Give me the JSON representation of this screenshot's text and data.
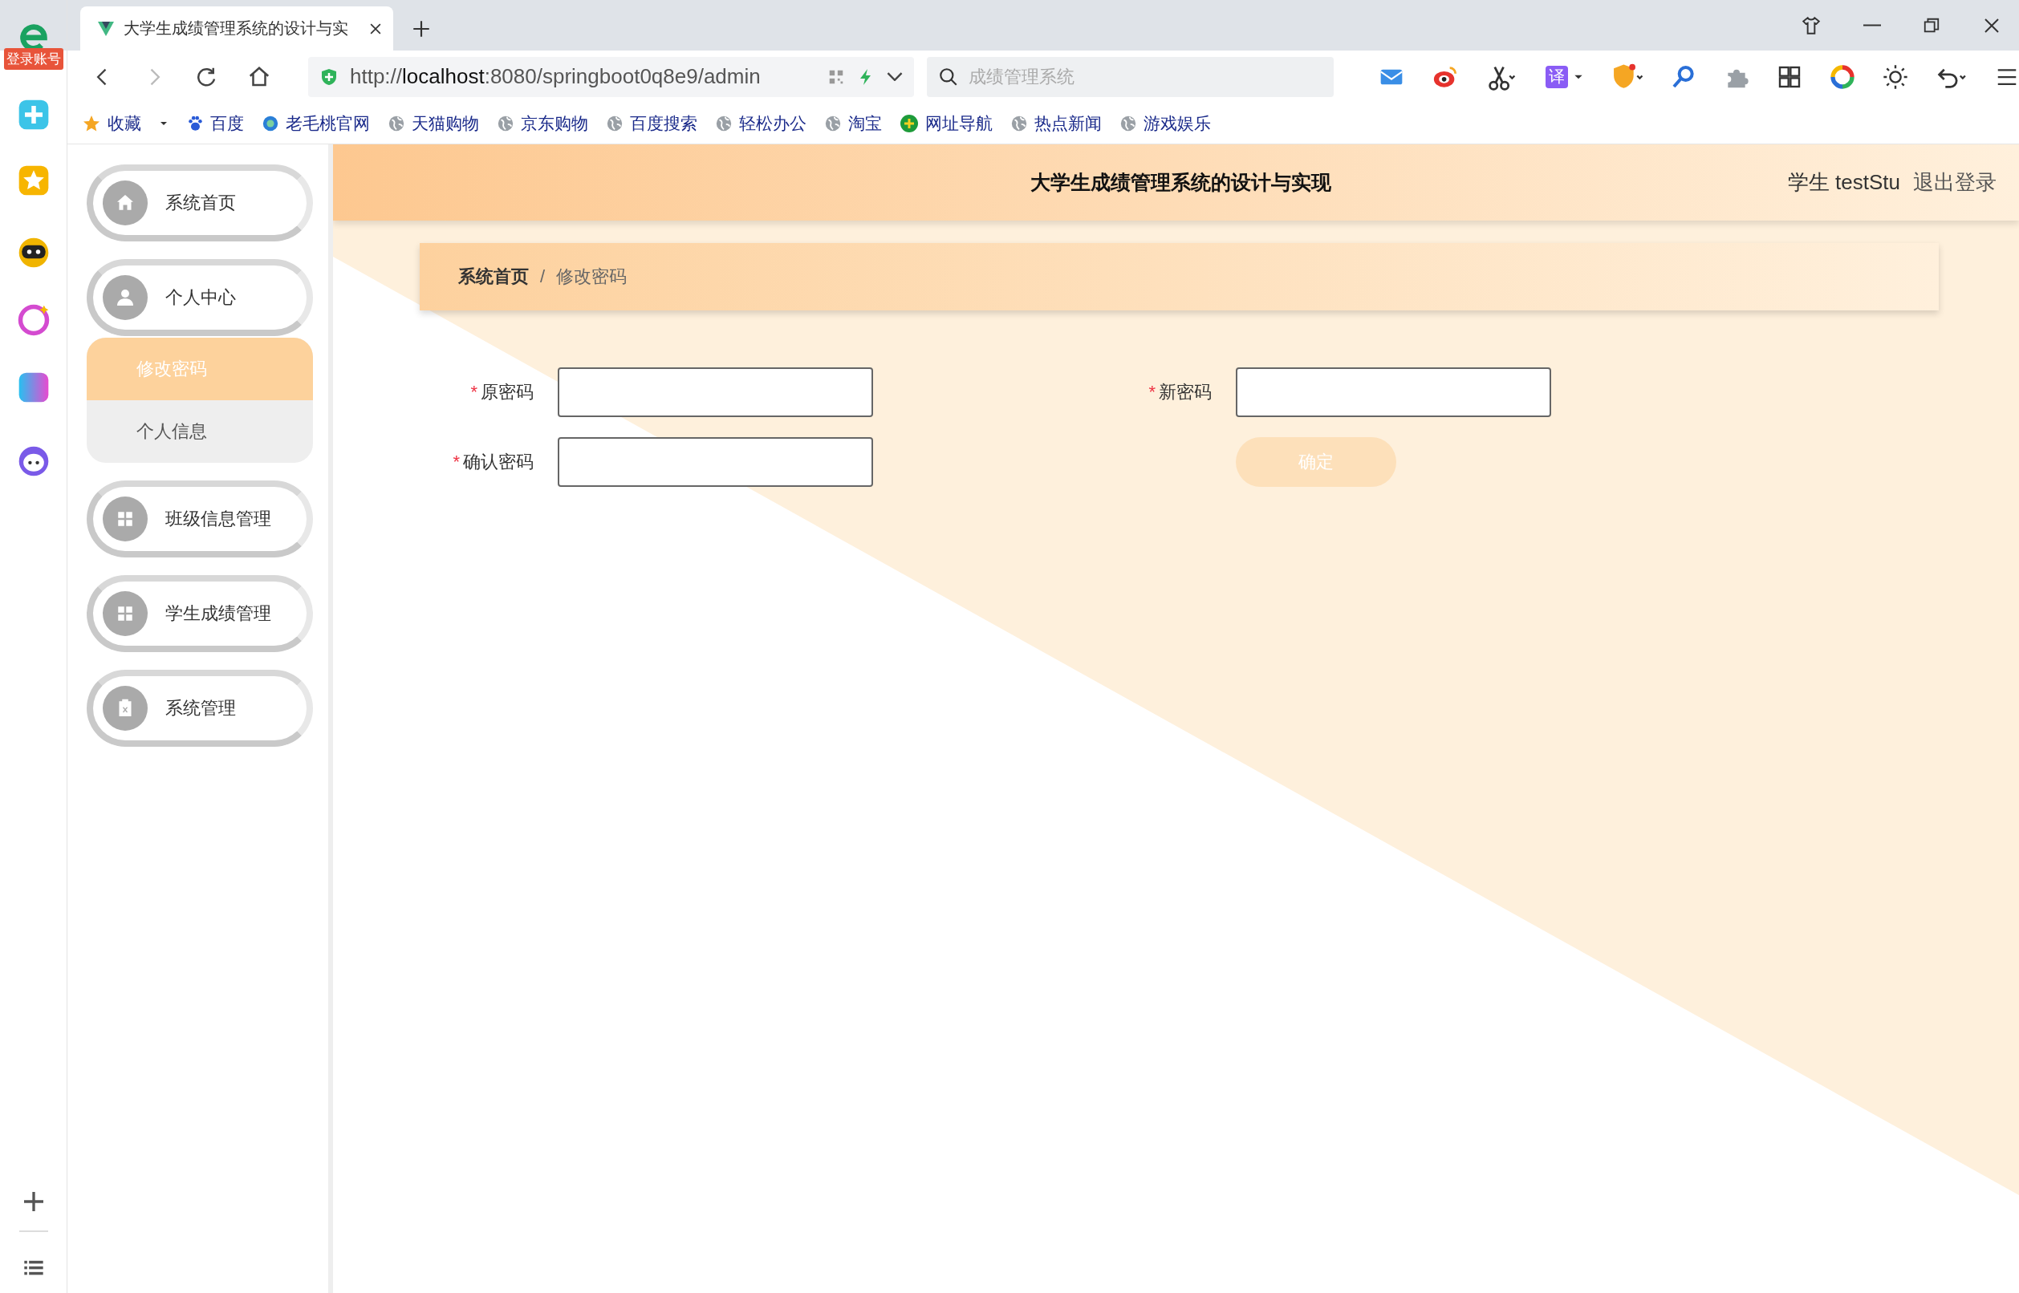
{
  "browser": {
    "side_badge": "登录账号",
    "tab_title": "大学生成绩管理系统的设计与实",
    "url": "http://**localhost**:8080/springboot0q8e9/admin",
    "search_placeholder": "成绩管理系统",
    "translate_label": "译",
    "bookmarks": [
      {
        "label": "收藏",
        "kind": "star"
      },
      {
        "label": "百度",
        "kind": "paw"
      },
      {
        "label": "老毛桃官网",
        "kind": "site"
      },
      {
        "label": "天猫购物",
        "kind": "globe"
      },
      {
        "label": "京东购物",
        "kind": "globe"
      },
      {
        "label": "百度搜索",
        "kind": "globe"
      },
      {
        "label": "轻松办公",
        "kind": "globe"
      },
      {
        "label": "淘宝",
        "kind": "globe"
      },
      {
        "label": "网址导航",
        "kind": "plus"
      },
      {
        "label": "热点新闻",
        "kind": "globe"
      },
      {
        "label": "游戏娱乐",
        "kind": "globe"
      }
    ]
  },
  "header": {
    "title": "大学生成绩管理系统的设计与实现",
    "user": "学生 testStu",
    "logout": "退出登录"
  },
  "menu": {
    "items": [
      {
        "label": "系统首页",
        "kind": "home"
      },
      {
        "label": "个人中心",
        "kind": "user",
        "children": [
          {
            "label": "修改密码",
            "selected": true
          },
          {
            "label": "个人信息",
            "selected": false
          }
        ]
      },
      {
        "label": "班级信息管理",
        "kind": "grid"
      },
      {
        "label": "学生成绩管理",
        "kind": "grid"
      },
      {
        "label": "系统管理",
        "kind": "clipboard"
      }
    ]
  },
  "breadcrumb": {
    "items": [
      "系统首页",
      "修改密码"
    ],
    "separator": "/"
  },
  "form": {
    "required_mark": "*",
    "fields": [
      {
        "label": "原密码",
        "required": true
      },
      {
        "label": "新密码",
        "required": true
      },
      {
        "label": "确认密码",
        "required": true
      }
    ],
    "submit": "确定"
  }
}
